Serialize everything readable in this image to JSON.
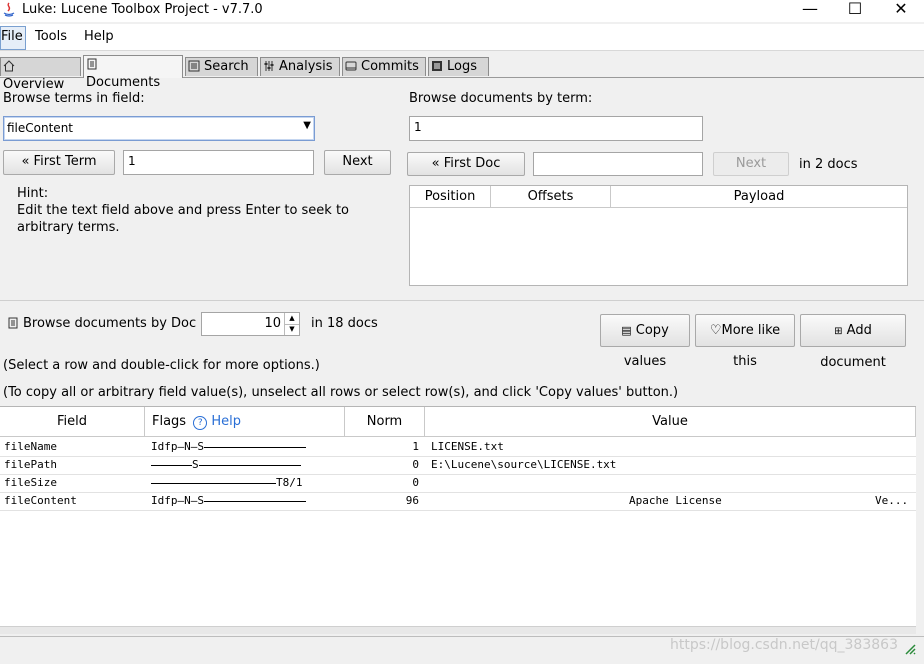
{
  "window": {
    "title": "Luke: Lucene Toolbox Project - v7.7.0",
    "minimize": "—",
    "maximize": "☐",
    "close": "✕"
  },
  "menu": {
    "items": [
      "File",
      "Tools",
      "Help"
    ]
  },
  "tabs": [
    {
      "label": "Overview",
      "icon": "home-icon",
      "active": false
    },
    {
      "label": "Documents",
      "icon": "document-icon",
      "active": true
    },
    {
      "label": "Search",
      "icon": "search-icon",
      "active": false
    },
    {
      "label": "Analysis",
      "icon": "sliders-icon",
      "active": false
    },
    {
      "label": "Commits",
      "icon": "book-icon",
      "active": false
    },
    {
      "label": "Logs",
      "icon": "log-icon",
      "active": false
    }
  ],
  "terms": {
    "heading": "Browse terms in field:",
    "field_value": "fileContent",
    "first_term_label": "First Term",
    "term_value": "1",
    "next_label": "Next",
    "hint_title": "Hint:",
    "hint_line1": "Edit the text field above and press Enter to seek to",
    "hint_line2": "arbitrary terms."
  },
  "docs_by_term": {
    "heading": "Browse documents by term:",
    "term_value": "1",
    "first_doc_label": "First Doc",
    "doc_value": "",
    "next_label": "Next",
    "count_text": "in 2 docs",
    "columns": [
      "Position",
      "Offsets",
      "Payload"
    ]
  },
  "doc_browser": {
    "label": "Browse documents by Doc #",
    "doc_number": "10",
    "count_text": "in 18 docs",
    "copy_values_label": "Copy values",
    "more_like_this_label": "More like this",
    "add_document_label": "Add document",
    "instruction1": "(Select a row and double-click for more options.)",
    "instruction2": "(To copy all or arbitrary field value(s), unselect all rows or select row(s), and click 'Copy values' button.)",
    "columns": {
      "field": "Field",
      "flags": "Flags",
      "help": "Help",
      "norm": "Norm",
      "value": "Value"
    },
    "rows": [
      {
        "field": "fileName",
        "flags_pre": "Idfp—N—S",
        "flags_post": "",
        "norm": "1",
        "value": "LICENSE.txt",
        "value_tail": ""
      },
      {
        "field": "filePath",
        "flags_pre": "",
        "flags_mid": "S",
        "flags_post": "",
        "norm": "0",
        "value": "E:\\Lucene\\source\\LICENSE.txt",
        "value_tail": ""
      },
      {
        "field": "fileSize",
        "flags_pre": "",
        "flags_post": "T8/1",
        "norm": "0",
        "value": "",
        "value_tail": ""
      },
      {
        "field": "fileContent",
        "flags_pre": "Idfp—N—S",
        "flags_post": "",
        "norm": "96",
        "value": "Apache License",
        "value_tail": "Ve..."
      }
    ]
  },
  "watermark": "https://blog.csdn.net/qq_383863"
}
